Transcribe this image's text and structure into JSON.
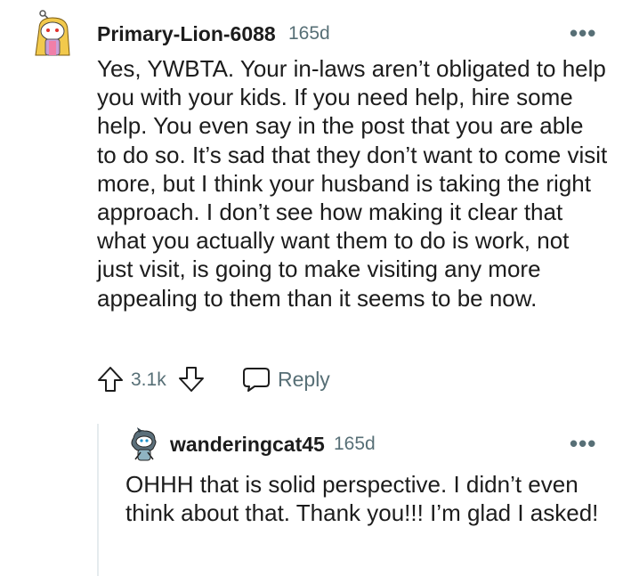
{
  "comment": {
    "username": "Primary-Lion-6088",
    "age": "165d",
    "more_label": "•••",
    "body": "Yes, YWBTA. Your in-laws aren’t obligated to help you with your kids. If you need help, hire some help. You even say in the post that you are able to do so. It’s sad that they don’t want to come visit more, but I think your husband is taking the right approach. I don’t see how making it clear that what you actually want them to do is work, not just visit, is going to make visiting any more appealing to them than it seems to be now.",
    "votes": "3.1k",
    "reply_label": "Reply"
  },
  "reply": {
    "username": "wanderingcat45",
    "age": "165d",
    "more_label": "•••",
    "body": "OHHH that is solid perspective. I didn’t even think about that. Thank you!!! I’m glad I asked!"
  },
  "icons": {
    "upvote": "arrow-up-icon",
    "downvote": "arrow-down-icon",
    "reply": "speech-bubble-icon",
    "more": "more-dots-icon"
  },
  "colors": {
    "text": "#1c1c1c",
    "muted": "#576f76",
    "thread_line": "#e5ebee"
  }
}
